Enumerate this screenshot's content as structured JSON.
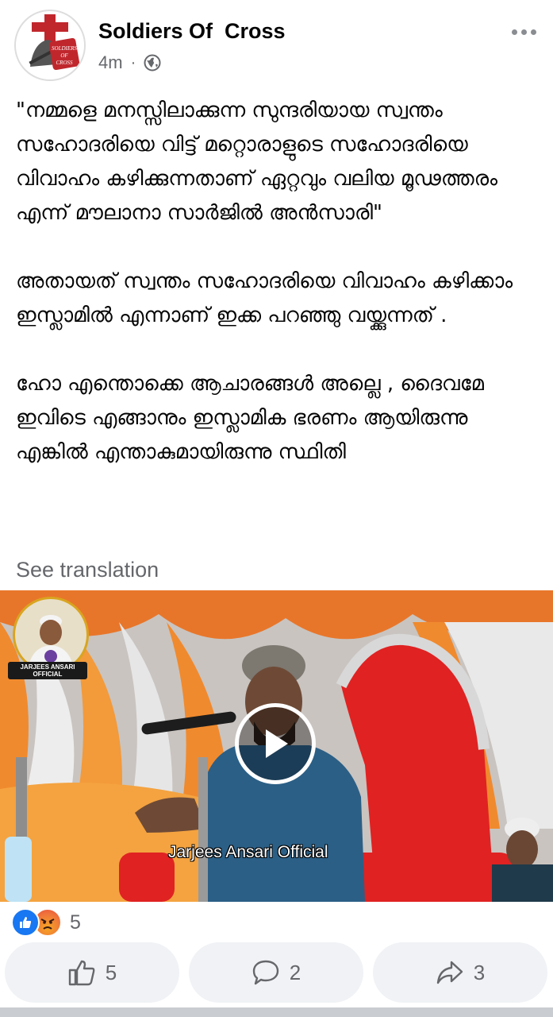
{
  "post": {
    "page_name": "Soldiers Of  Cross",
    "time": "4m",
    "separator": "·",
    "avatar_text": [
      "SOLDIERS",
      "OF",
      "CROSS"
    ],
    "paragraphs": [
      "\"നമ്മളെ മനസ്സിലാക്കുന്ന സുന്ദരിയായ സ്വന്തം സഹോദരിയെ വിട്ട് മറ്റൊരാളുടെ സഹോദരിയെ വിവാഹം കഴിക്കുന്നതാണ് ഏറ്റവും വലിയ മൂഢത്തരം എന്ന് മൗലാനാ സാർജിൽ അൻസാരി\"",
      "അതായത് സ്വന്തം സഹോദരിയെ വിവാഹം കഴിക്കാം ഇസ്ലാമിൽ എന്നാണ് ഇക്ക പറഞ്ഞു വയ്ക്കുന്നത് .",
      "ഹോ എന്തൊക്കെ ആചാരങ്ങൾ അല്ലെ , ദൈവമേ ഇവിടെ എങ്ങാനും ഇസ്ലാമിക ഭരണം ആയിരുന്നു എങ്കിൽ എന്താകുമായിരുന്നു സ്ഥിതി"
    ],
    "see_translation": "See translation"
  },
  "video": {
    "channel_logo_label": "JARJEES ANSARI OFFICIAL",
    "watermark": "Jarjees Ansari Official"
  },
  "reactions": {
    "icons": [
      "like-icon",
      "angry-icon"
    ],
    "count": "5"
  },
  "actions": {
    "like_count": "5",
    "comment_count": "2",
    "share_count": "3"
  },
  "colors": {
    "brand_blue": "#1877f2",
    "secondary_text": "#65676b",
    "button_bg": "#f0f2f5"
  }
}
